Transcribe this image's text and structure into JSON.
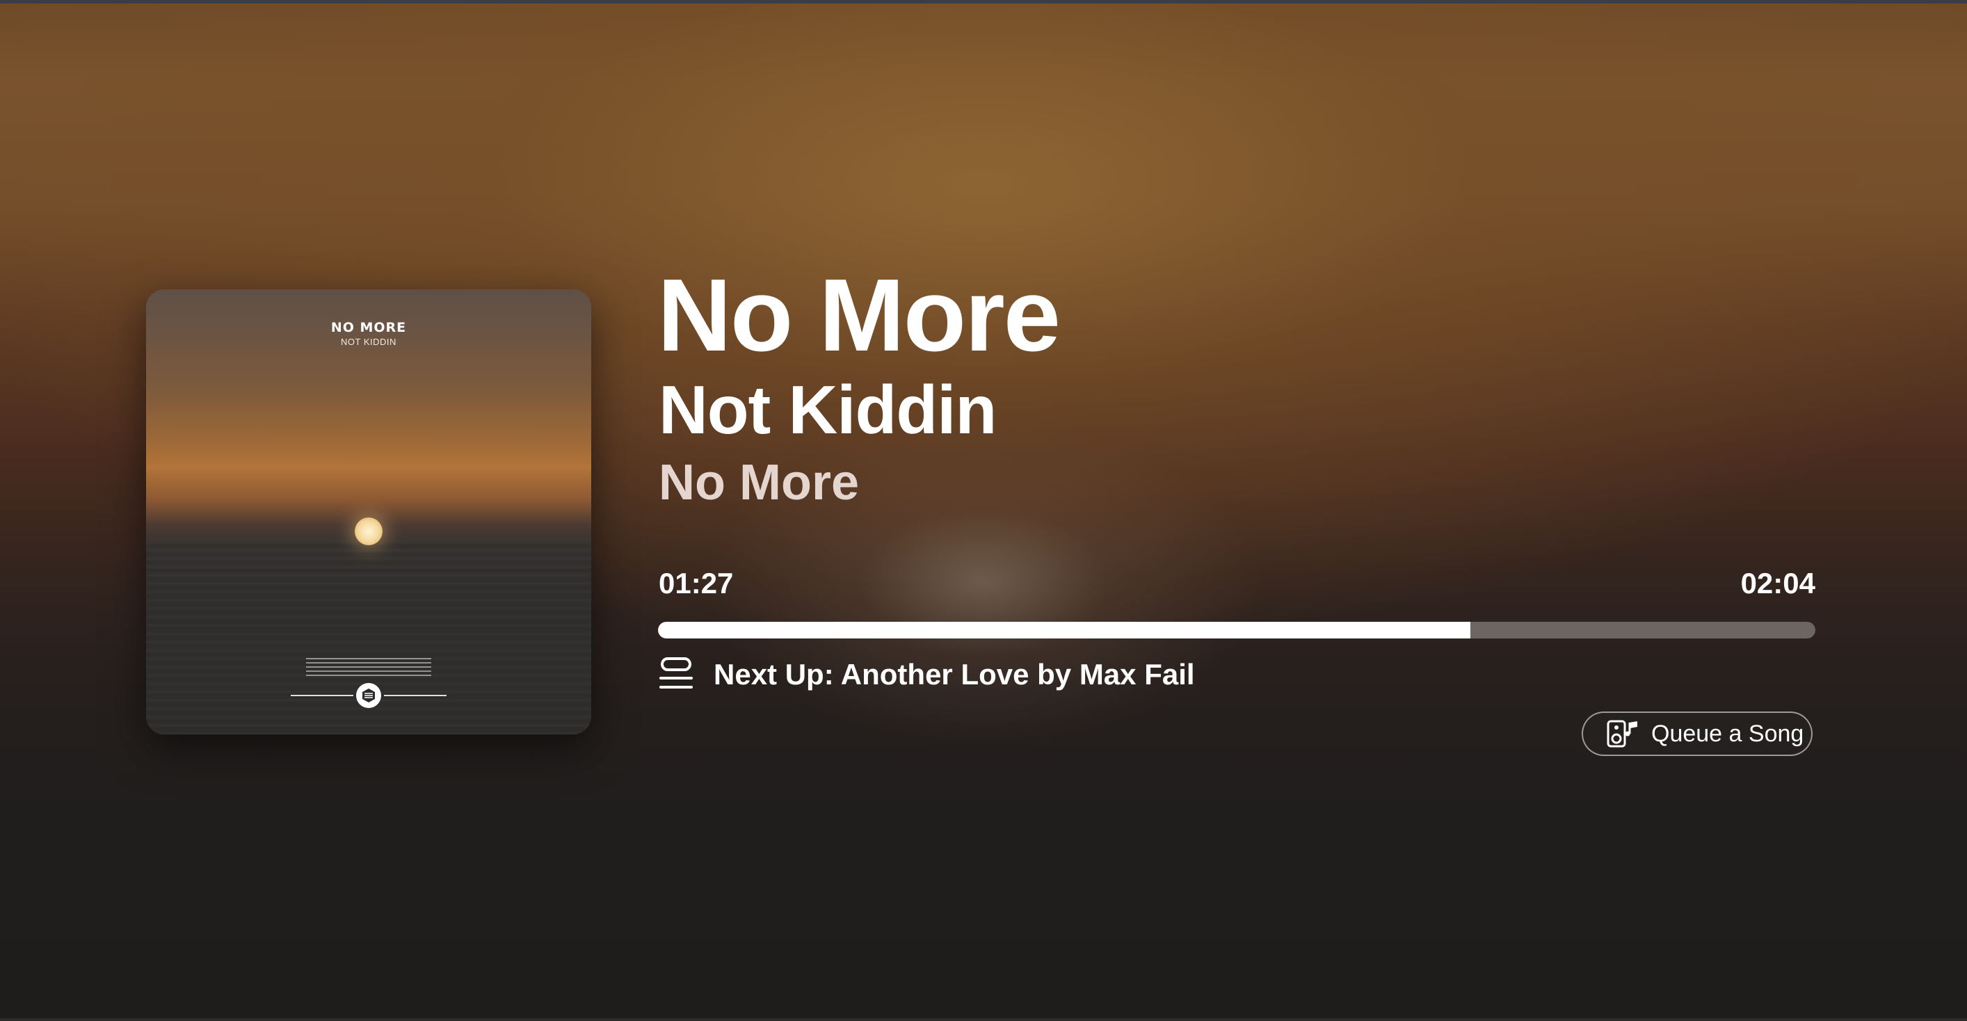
{
  "album_art": {
    "title": "NO MORE",
    "artist": "NOT KIDDIN"
  },
  "track": {
    "title": "No More",
    "artist": "Not Kiddin",
    "album": "No More"
  },
  "playback": {
    "elapsed": "01:27",
    "total": "02:04",
    "progress": 0.702
  },
  "next_up": {
    "label": "Next Up: Another Love by Max Fail",
    "icon": "queue-list-icon"
  },
  "queue_button": {
    "label": "Queue a Song",
    "icon": "speaker-music-icon"
  },
  "colors": {
    "progress_fill": "#ffffff",
    "progress_track": "#6d6562",
    "album_subtitle": "#e4d6cf"
  }
}
